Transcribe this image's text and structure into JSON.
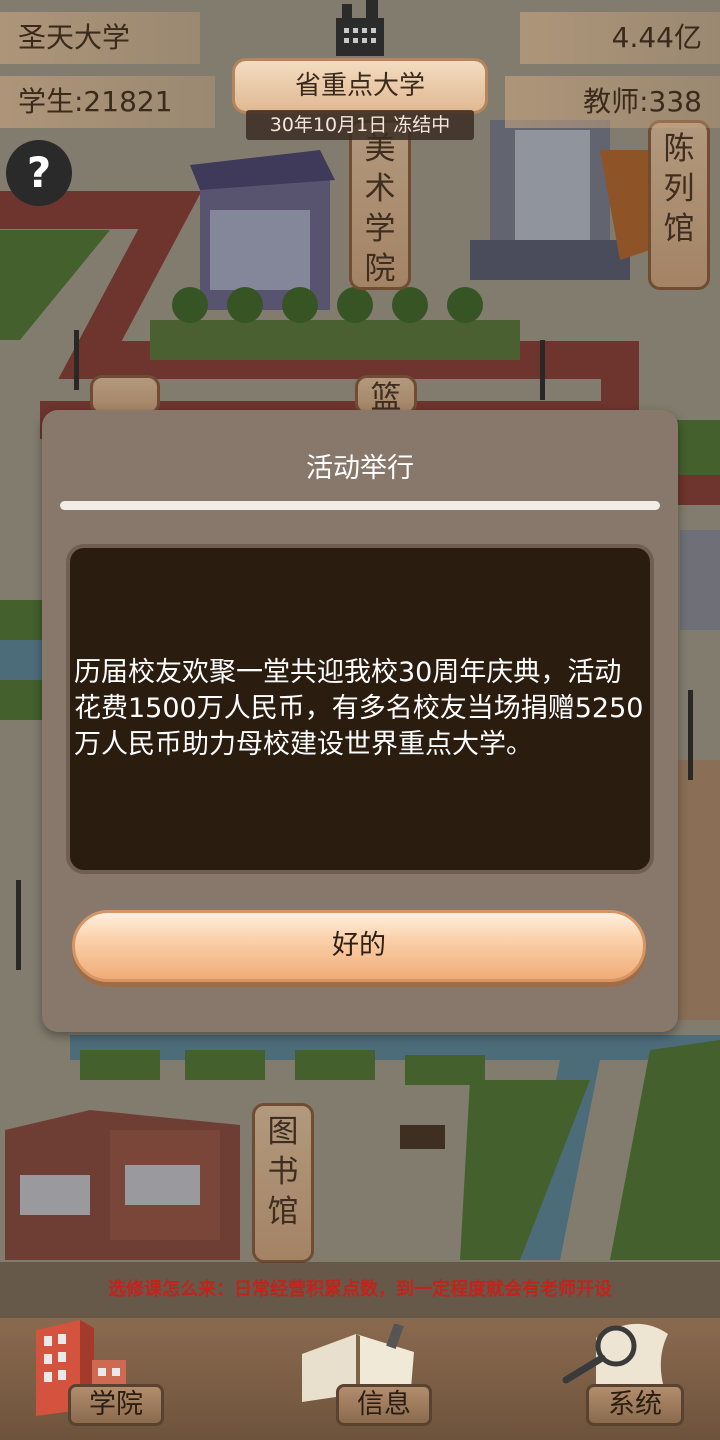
{
  "hud": {
    "school_name": "圣天大学",
    "money": "4.44亿",
    "students": "学生:21821",
    "teachers": "教师:338",
    "rank_title": "省重点大学",
    "date_status": "30年10月1日 冻结中",
    "help_label": "?"
  },
  "map": {
    "building_labels": [
      "美术学院",
      "陈列馆",
      "图书馆",
      "篮"
    ]
  },
  "dialog": {
    "title": "活动举行",
    "message": "历届校友欢聚一堂共迎我校30周年庆典，活动花费1500万人民币，有多名校友当场捐赠5250万人民币助力母校建设世界重点大学。",
    "confirm_label": "好的"
  },
  "ticker": "选修课怎么来：日常经营积累点数，到一定程度就会有老师开设",
  "nav": {
    "colleges": "学院",
    "info": "信息",
    "system": "系统"
  },
  "colors": {
    "dialog_bg": "#87786b",
    "message_bg": "#2b1c10",
    "button": "#f7c497",
    "ticker_text": "#c2231b"
  }
}
